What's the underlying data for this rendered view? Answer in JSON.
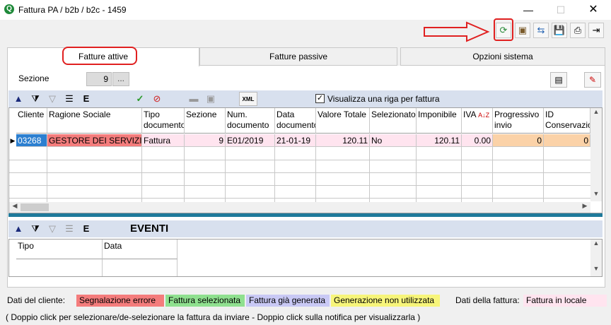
{
  "window": {
    "title": "Fattura PA / b2b / b2c - 1459",
    "controls": [
      "—",
      "☐",
      "✕"
    ]
  },
  "toolbar": {
    "icons": [
      "⟳",
      "▣",
      "⇆",
      "💾",
      "⎙",
      "⇥"
    ]
  },
  "tabs": [
    {
      "label": "Fatture attive",
      "active": true
    },
    {
      "label": "Fatture passive",
      "active": false
    },
    {
      "label": "Opzioni sistema",
      "active": false
    }
  ],
  "sezione": {
    "label": "Sezione",
    "value": "9",
    "lookup": "..."
  },
  "grid_toolbar": {
    "checkbox_label": "Visualizza una riga per fattura",
    "checked": true,
    "xml_label": "XML"
  },
  "grid": {
    "columns": [
      "Cliente",
      "Ragione Sociale",
      "Tipo documento",
      "Sezione",
      "Num. documento",
      "Data documento",
      "Valore Totale",
      "Selezionato",
      "Imponibile",
      "IVA",
      "Progressivo invio",
      "ID Conservazio"
    ],
    "rows": [
      [
        "03268",
        "GESTORE DEI SERVIZI",
        "Fattura",
        "9",
        "E01/2019",
        "21-01-19",
        "120.11",
        "No",
        "120.11",
        "0.00",
        "0",
        "0"
      ]
    ]
  },
  "events": {
    "title": "EVENTI",
    "columns": [
      "Tipo",
      "Data"
    ]
  },
  "legend": {
    "cliente_label": "Dati del cliente:",
    "items": [
      {
        "label": "Segnalazione errore",
        "color": "#f47c7c"
      },
      {
        "label": "Fattura selezionata",
        "color": "#8fe08f"
      },
      {
        "label": "Fattura già generata",
        "color": "#c9c9f5"
      },
      {
        "label": "Generazione non utilizzata",
        "color": "#f7f57a"
      }
    ],
    "fattura_label": "Dati della fattura:",
    "fattura_item": {
      "label": "Fattura in locale",
      "color": "#ffe4ef"
    }
  },
  "footer": "( Doppio click per selezionare/de-selezionare la fattura da inviare - Doppio click sulla notifica per visualizzarla )",
  "colors": {
    "accent_red": "#e02020",
    "row_pink": "#ffe4ef",
    "row_peach": "#fbd2a8",
    "header_blue": "#d8e0ee",
    "splitter": "#1f7a9b"
  }
}
